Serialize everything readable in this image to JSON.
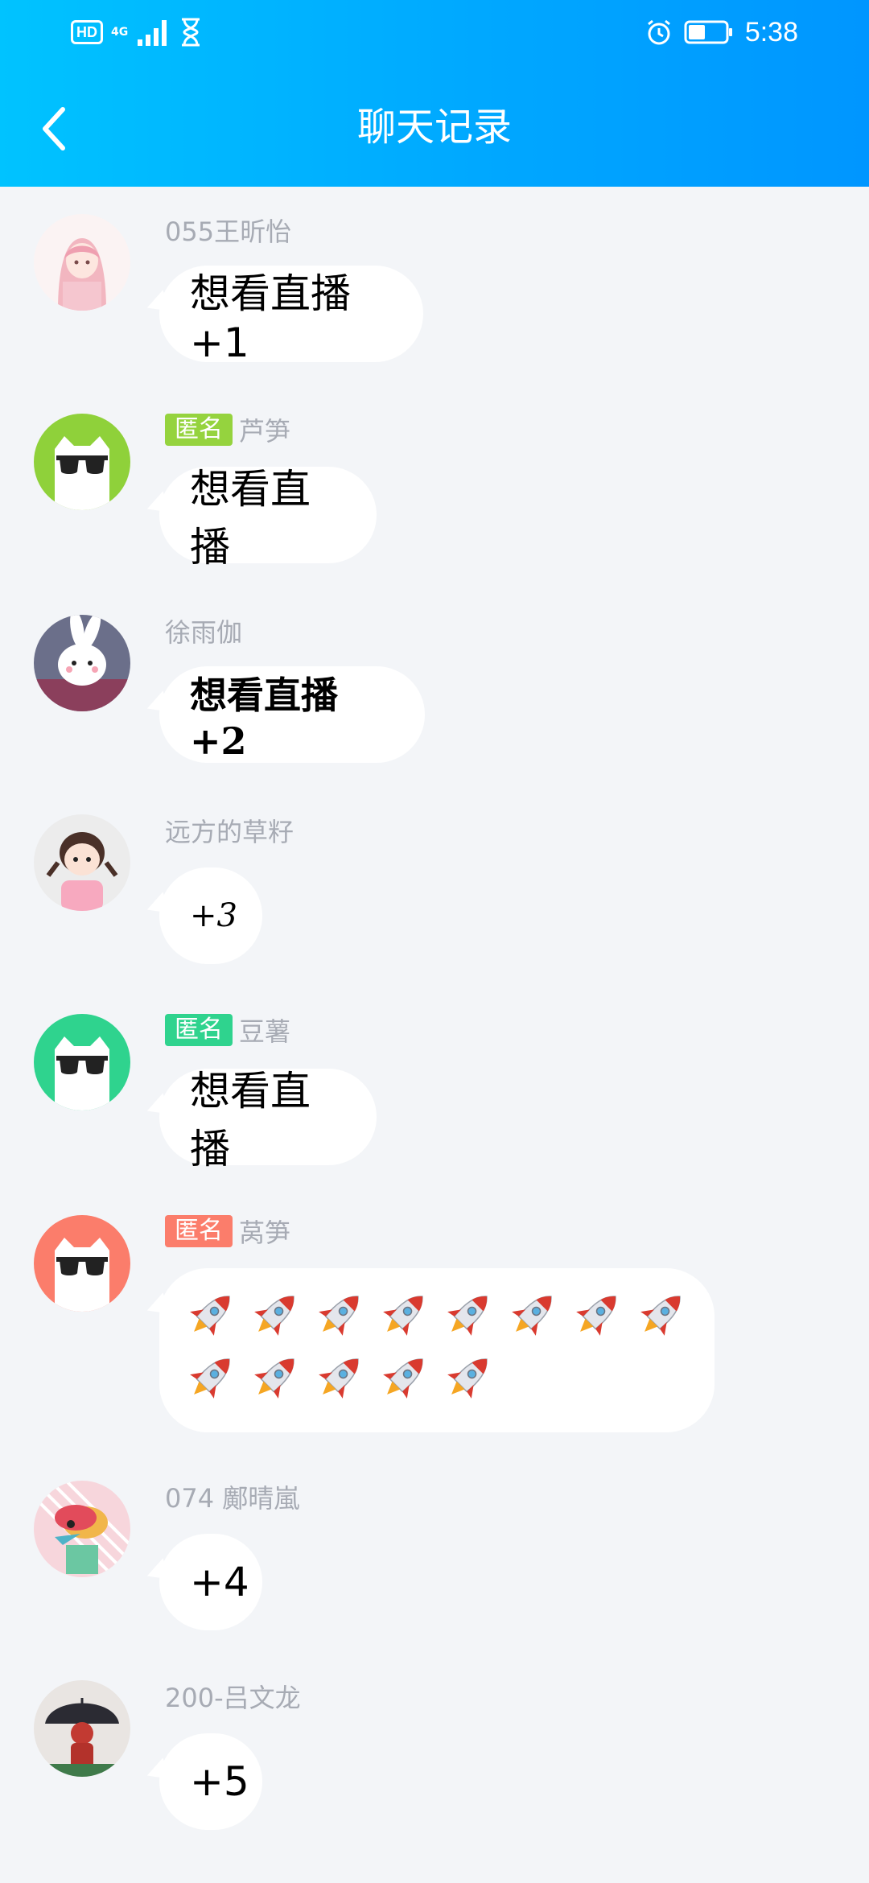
{
  "status_bar": {
    "hd": "HD",
    "network": "4G",
    "time": "5:38",
    "icons": [
      "signal-icon",
      "hourglass-icon",
      "alarm-icon",
      "battery-icon"
    ]
  },
  "nav": {
    "title": "聊天记录",
    "back_icon": "chevron-left-icon"
  },
  "colors": {
    "header_gradient": [
      "#00c3ff",
      "#0096ff"
    ],
    "bubble": "#ffffff",
    "background": "#f3f5f8",
    "sender_text": "#a7abb4"
  },
  "messages": [
    {
      "sender": "055王昕怡",
      "anonymous": false,
      "text": "想看直播+1",
      "avatar": "girl-illustration-avatar"
    },
    {
      "sender": "芦笋",
      "anonymous": true,
      "anon_label": "匿名",
      "anon_color": "#95d33e",
      "text": "想看直播",
      "avatar": "sunglasses-cat-avatar-lime"
    },
    {
      "sender": "徐雨伽",
      "anonymous": false,
      "text": "想看直播+2",
      "avatar": "rabbit-avatar"
    },
    {
      "sender": "远方的草籽",
      "anonymous": false,
      "text": "+3",
      "avatar": "girl-braids-avatar"
    },
    {
      "sender": "豆薯",
      "anonymous": true,
      "anon_label": "匿名",
      "anon_color": "#2fd38e",
      "text": "想看直播",
      "avatar": "sunglasses-cat-avatar-green"
    },
    {
      "sender": "莴笋",
      "anonymous": true,
      "anon_label": "匿名",
      "anon_color": "#fb7d6b",
      "emoji": "rocket-icon",
      "emoji_count": 13,
      "avatar": "sunglasses-cat-avatar-coral"
    },
    {
      "sender": "074 鄺晴嵐",
      "anonymous": false,
      "text": "+4",
      "avatar": "cartoon-duck-avatar"
    },
    {
      "sender": "200-吕文龙",
      "anonymous": false,
      "text": "+5",
      "avatar": "astronaut-umbrella-avatar"
    }
  ]
}
